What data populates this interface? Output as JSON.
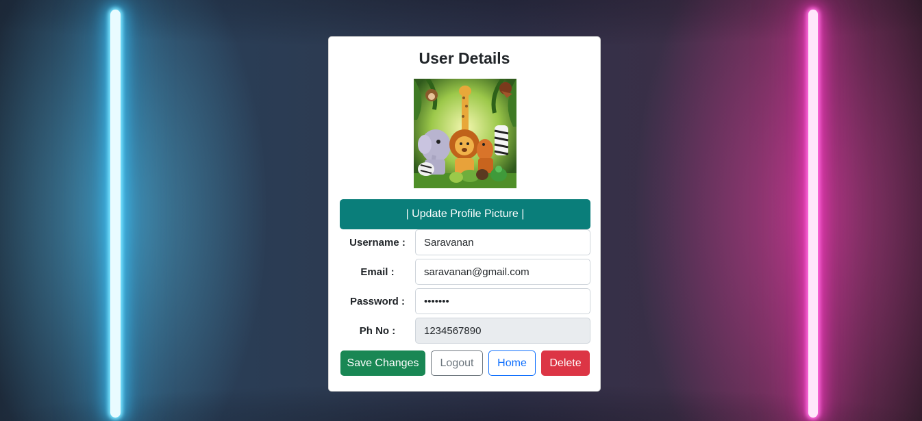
{
  "card": {
    "title": "User Details",
    "avatar_icon": "cartoon-jungle-animals-picture",
    "update_picture_label": "| Update Profile Picture |"
  },
  "form": {
    "username": {
      "label": "Username :",
      "value": "Saravanan"
    },
    "email": {
      "label": "Email :",
      "value": "saravanan@gmail.com"
    },
    "password": {
      "label": "Password :",
      "value": "•••••••"
    },
    "phone": {
      "label": "Ph No :",
      "value": "1234567890"
    }
  },
  "actions": {
    "save_label": "Save Changes",
    "logout_label": "Logout",
    "home_label": "Home",
    "delete_label": "Delete"
  },
  "colors": {
    "update_button": "#0a7e7a",
    "save_button": "#198754",
    "logout_outline": "#6c757d",
    "home_outline": "#0d6efd",
    "delete_button": "#dc3545",
    "neon_left": "#7ee6ff",
    "neon_right": "#ff6ee0"
  }
}
